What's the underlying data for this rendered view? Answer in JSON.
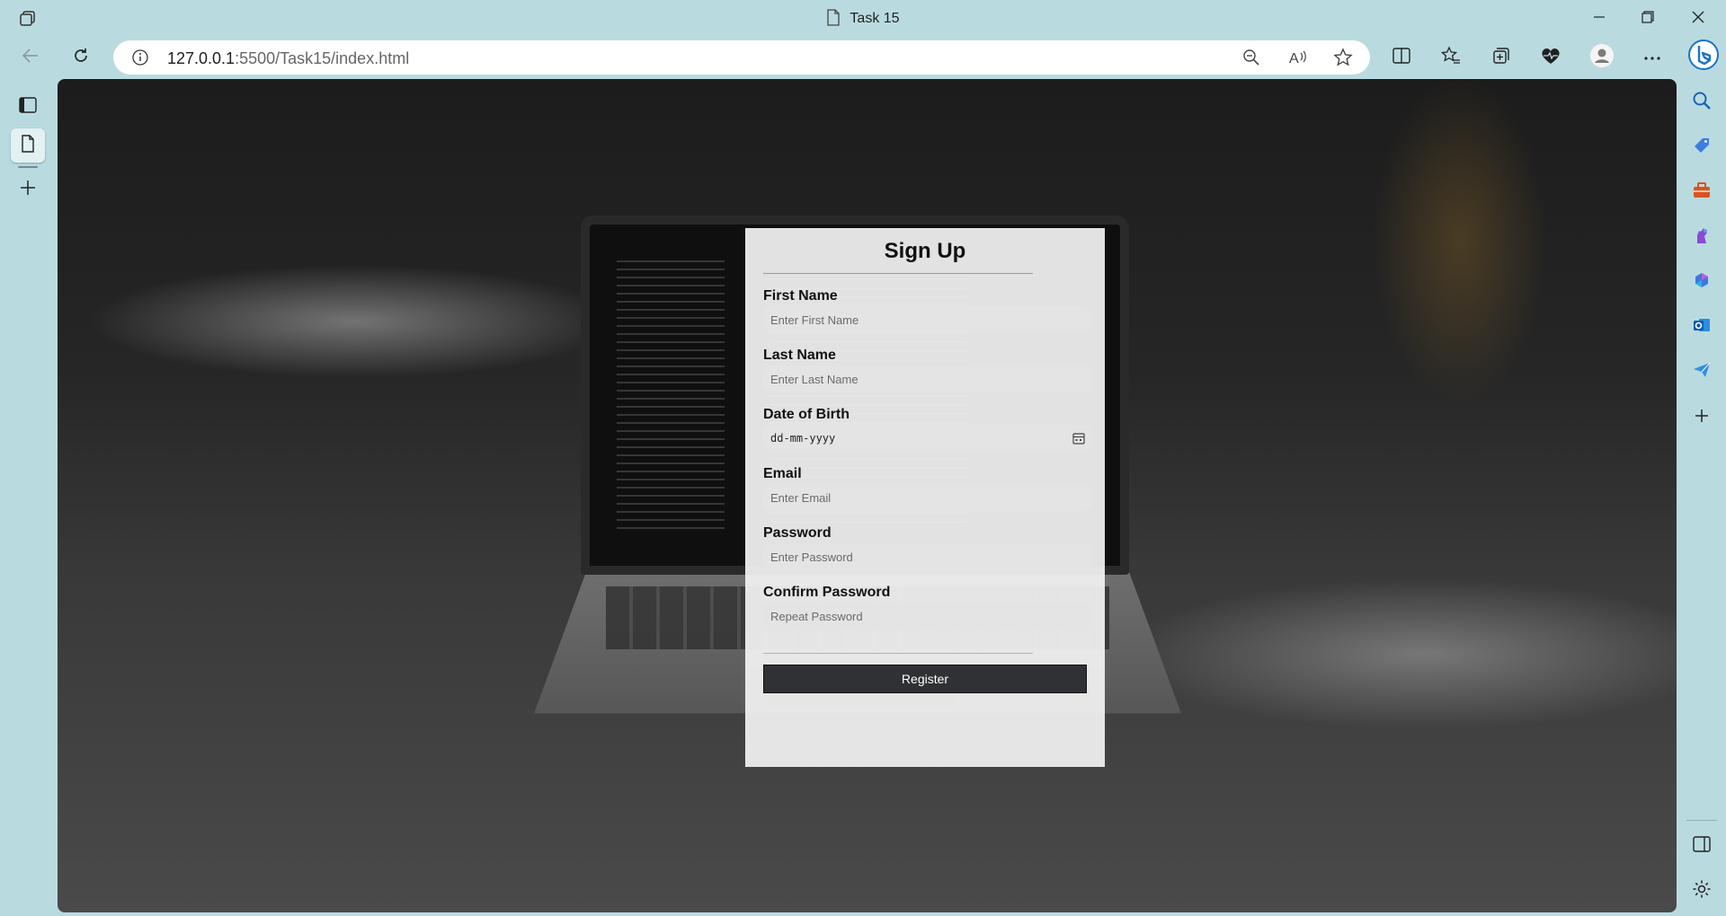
{
  "browser": {
    "tab_title": "Task 15",
    "url_host": "127.0.0.1",
    "url_rest": ":5500/Task15/index.html",
    "icons": {
      "app": "workspaces-icon",
      "tab_doc": "document-icon",
      "minimize": "minimize-icon",
      "restore": "restore-icon",
      "close": "close-icon",
      "back": "back-arrow-icon",
      "refresh": "refresh-icon",
      "info": "info-icon",
      "zoom": "zoom-out-icon",
      "read_aloud": "read-aloud-icon",
      "favorite": "star-icon",
      "split": "split-screen-icon",
      "favorites": "favorites-icon",
      "collections": "collections-icon",
      "health": "browser-essentials-icon",
      "profile": "profile-avatar-icon",
      "more": "more-icon",
      "copilot": "bing-icon"
    }
  },
  "left_sidebar": {
    "items": [
      "tab-actions-icon",
      "page-tab-icon",
      "new-tab-icon"
    ]
  },
  "right_sidebar": {
    "items": [
      "search-icon",
      "shopping-icon",
      "tools-icon",
      "games-icon",
      "microsoft365-icon",
      "outlook-icon",
      "drop-icon",
      "add-icon"
    ],
    "bottom": [
      "sidebar-toggle-icon",
      "settings-icon"
    ]
  },
  "form": {
    "title": "Sign Up",
    "fields": [
      {
        "label": "First Name",
        "placeholder": "Enter First Name"
      },
      {
        "label": "Last Name",
        "placeholder": "Enter Last Name"
      },
      {
        "label": "Date of Birth",
        "placeholder": "dd-mm-yyyy"
      },
      {
        "label": "Email",
        "placeholder": "Enter Email"
      },
      {
        "label": "Password",
        "placeholder": "Enter Password"
      },
      {
        "label": "Confirm Password",
        "placeholder": "Repeat Password"
      }
    ],
    "submit_label": "Register"
  },
  "colors": {
    "chrome": "#b9dbe0",
    "card_bg": "#f2f2f2",
    "input_bg": "#e4e4e4",
    "button_bg": "#2f3134",
    "accent": "#0a66c2"
  }
}
